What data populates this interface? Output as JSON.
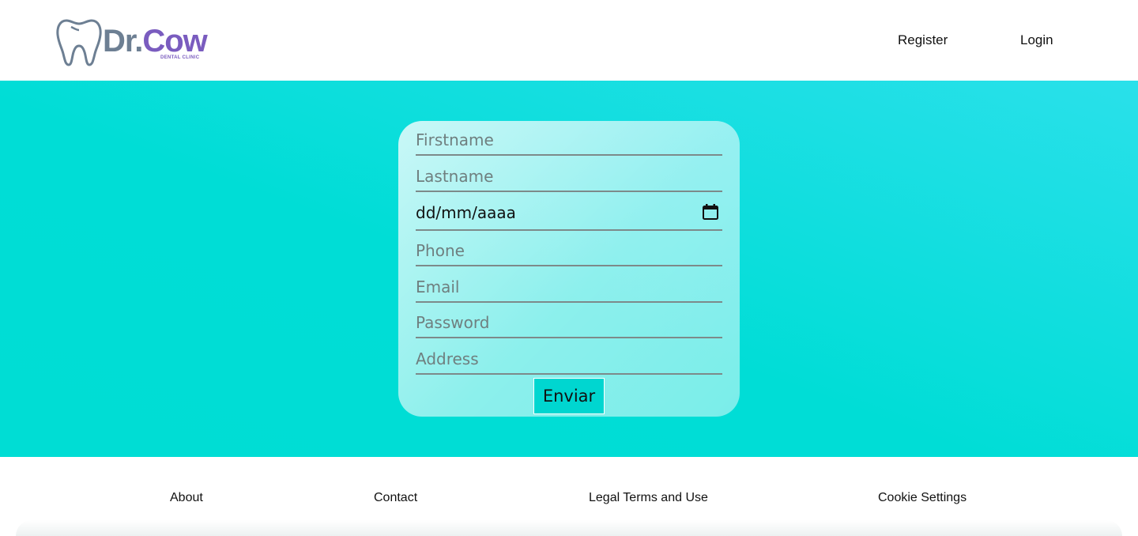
{
  "brand": {
    "name_part1": "Dr.",
    "name_part2": "Cow",
    "tagline": "DENTAL CLINIC",
    "icon": "tooth-icon",
    "colors": {
      "gray": "#6d7f93",
      "purple": "#7a5cbf"
    }
  },
  "nav": {
    "register_label": "Register",
    "login_label": "Login"
  },
  "form": {
    "firstname_placeholder": "Firstname",
    "lastname_placeholder": "Lastname",
    "birthdate_placeholder": "dd/mm/aaaa",
    "birthdate_icon": "calendar-icon",
    "phone_placeholder": "Phone",
    "email_placeholder": "Email",
    "password_placeholder": "Password",
    "address_placeholder": "Address",
    "submit_label": "Enviar"
  },
  "footer": {
    "about_label": "About",
    "contact_label": "Contact",
    "legal_label": "Legal Terms and Use",
    "cookie_label": "Cookie Settings"
  },
  "theme": {
    "hero_color": "#00ddd6",
    "button_color": "#00d6d0"
  }
}
